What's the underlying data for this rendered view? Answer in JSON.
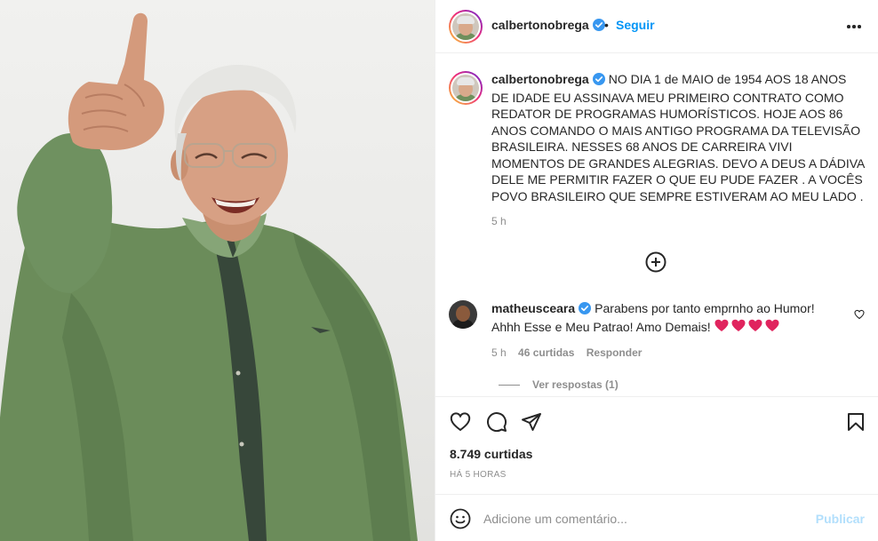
{
  "post": {
    "username": "calbertonobrega",
    "follow_label": "Seguir",
    "separator": "•",
    "caption": "NO DIA 1 de MAIO de 1954 AOS 18 ANOS DE IDADE EU ASSINAVA MEU PRIMEIRO CONTRATO COMO REDATOR DE PROGRAMAS HUMORÍSTICOS. HOJE AOS 86 ANOS COMANDO O MAIS ANTIGO PROGRAMA DA TELEVISÃO BRASILEIRA. NESSES 68 ANOS DE CARREIRA VIVI MOMENTOS DE GRANDES ALEGRIAS. DEVO A DEUS A DÁDIVA DELE ME PERMITIR FAZER O QUE EU PUDE FAZER . A VOCÊS POVO BRASILEIRO QUE SEMPRE ESTIVERAM AO MEU LADO .",
    "caption_time": "5 h",
    "likes": "8.749 curtidas",
    "time_ago": "HÁ 5 HORAS"
  },
  "comment": {
    "username": "matheusceara",
    "text": "Parabens por tanto emprnho ao Humor! Ahhh Esse e Meu Patrao! Amo Demais!",
    "time": "5 h",
    "likes": "46 curtidas",
    "reply_label": "Responder",
    "view_replies": "Ver respostas (1)"
  },
  "add_comment": {
    "placeholder": "Adicione um comentário...",
    "publish_label": "Publicar"
  },
  "icons": {
    "verified": "verified-badge-icon",
    "more": "more-options-icon",
    "load_more": "plus-circle-icon",
    "like": "heart-icon",
    "comment": "comment-bubble-icon",
    "share": "paper-plane-icon",
    "save": "bookmark-icon",
    "emoji": "smiley-icon"
  },
  "colors": {
    "link_blue": "#0095f6",
    "publish_disabled": "#b2dffc",
    "verified_blue": "#3897f0",
    "heart_red": "#ed4956",
    "muted": "#8e8e8e"
  }
}
